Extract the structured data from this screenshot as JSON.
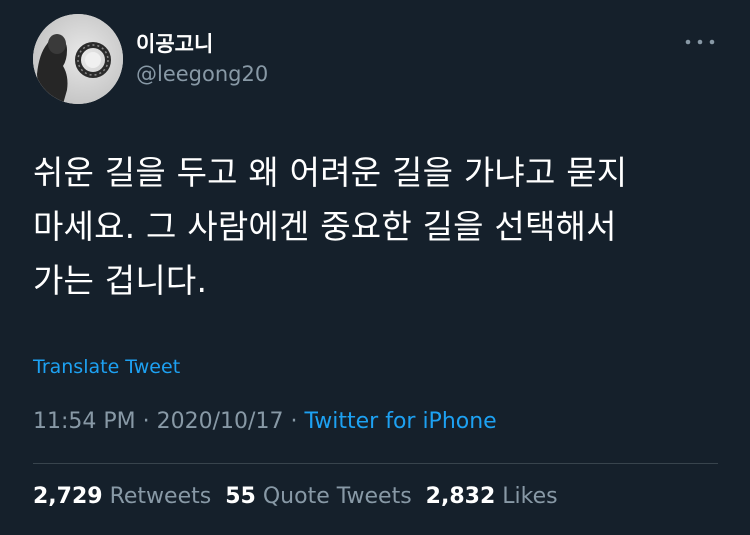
{
  "user": {
    "display_name": "이공고니",
    "handle": "@leegong20",
    "avatar": "avatar"
  },
  "menu_icon": "more-horizontal-icon",
  "tweet": {
    "text": "쉬운 길을 두고 왜 어려운 길을 가냐고 묻지\n마세요. 그 사람에겐 중요한 길을 선택해서\n가는 겁니다."
  },
  "translate_label": "Translate Tweet",
  "meta": {
    "time": "11:54 PM",
    "separator": "·",
    "date": "2020/10/17",
    "source": "Twitter for iPhone"
  },
  "stats": {
    "retweets_count": "2,729",
    "retweets_label": "Retweets",
    "quote_count": "55",
    "quote_label": "Quote Tweets",
    "likes_count": "2,832",
    "likes_label": "Likes"
  },
  "colors": {
    "background": "#15202b",
    "text_primary": "#ffffff",
    "text_secondary": "#8899a6",
    "link": "#1da1f2",
    "divider": "#38444d"
  }
}
